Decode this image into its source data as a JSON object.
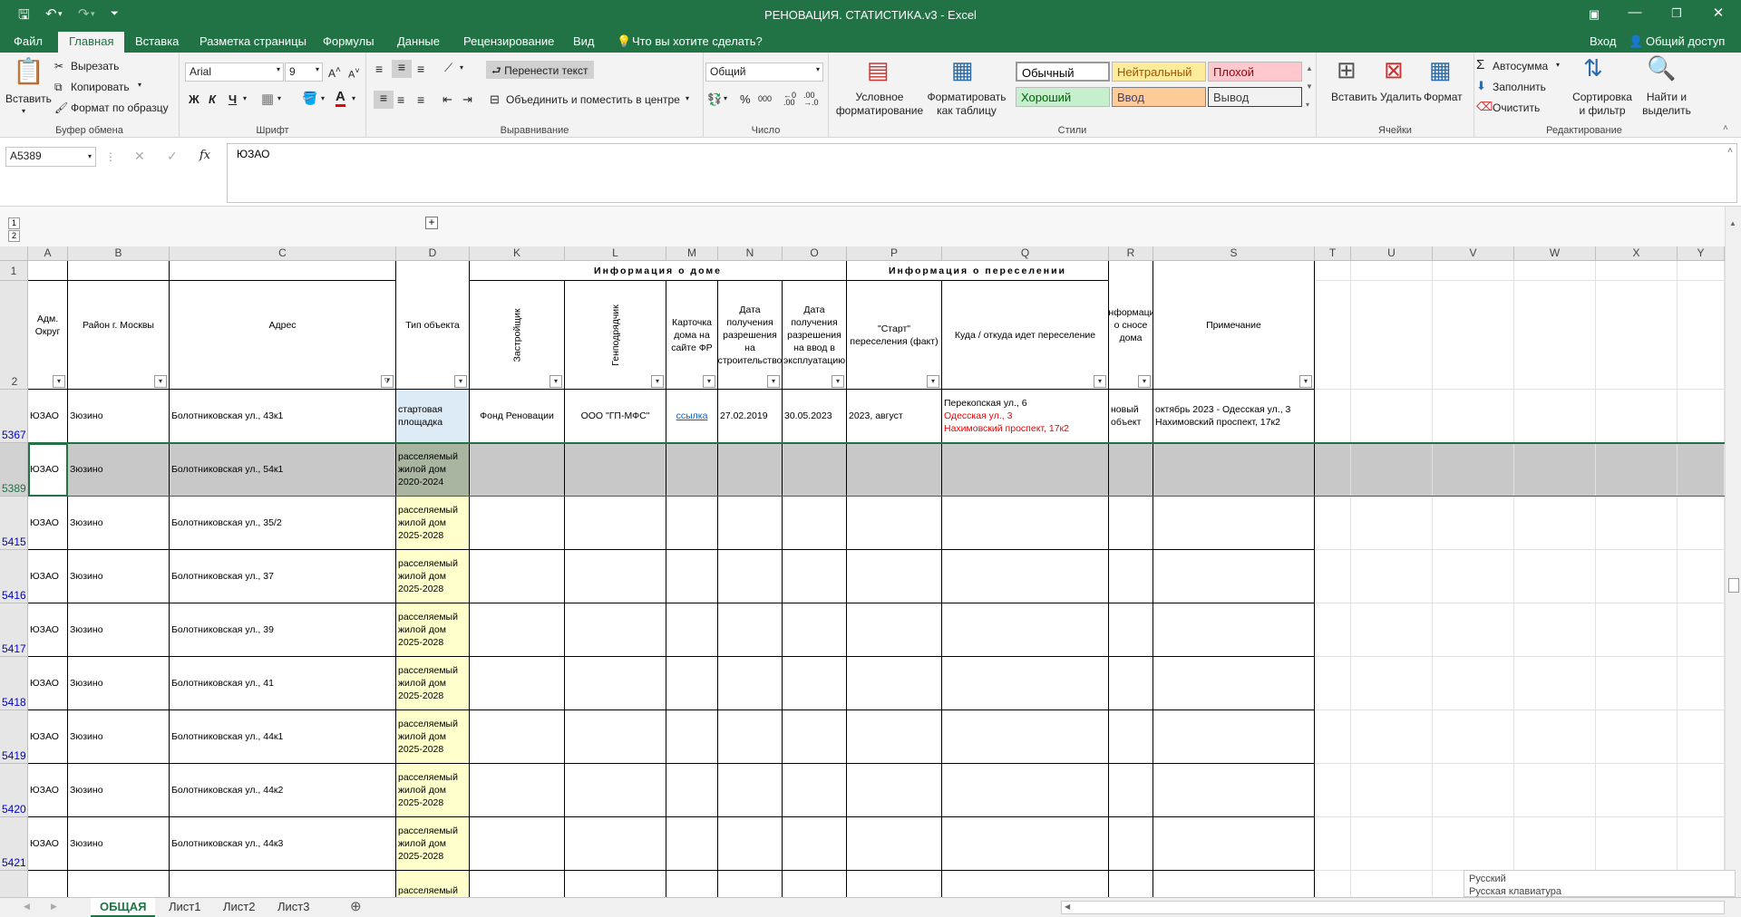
{
  "title": "РЕНОВАЦИЯ. СТАТИСТИКА.v3 - Excel",
  "account": {
    "login": "Вход",
    "share": "Общий доступ"
  },
  "tabs": [
    "Файл",
    "Главная",
    "Вставка",
    "Разметка страницы",
    "Формулы",
    "Данные",
    "Рецензирование",
    "Вид"
  ],
  "tell_me": "Что вы хотите сделать?",
  "ribbon": {
    "clipboard": {
      "paste": "Вставить",
      "cut": "Вырезать",
      "copy": "Копировать",
      "format_painter": "Формат по образцу",
      "label": "Буфер обмена"
    },
    "font": {
      "name": "Arial",
      "size": "9",
      "bold": "Ж",
      "italic": "К",
      "underline": "Ч",
      "label": "Шрифт"
    },
    "alignment": {
      "wrap": "Перенести текст",
      "merge": "Объединить и поместить в центре",
      "label": "Выравнивание"
    },
    "number": {
      "format": "Общий",
      "percent": "%",
      "thousands": "000",
      "label": "Число"
    },
    "styles": {
      "conditional": "Условное форматирование",
      "as_table": "Форматировать как таблицу",
      "normal": "Обычный",
      "neutral": "Нейтральный",
      "bad": "Плохой",
      "good": "Хороший",
      "input": "Ввод",
      "output": "Вывод",
      "label": "Стили"
    },
    "cells": {
      "insert": "Вставить",
      "delete": "Удалить",
      "format": "Формат",
      "label": "Ячейки"
    },
    "editing": {
      "autosum": "Автосумма",
      "fill": "Заполнить",
      "clear": "Очистить",
      "sort": "Сортировка и фильтр",
      "find": "Найти и выделить",
      "label": "Редактирование"
    }
  },
  "formula_bar": {
    "name_box": "A5389",
    "fx": "fx",
    "value": "ЮЗАО"
  },
  "outline_levels": [
    "1",
    "2"
  ],
  "columns": [
    "A",
    "B",
    "C",
    "D",
    "K",
    "L",
    "M",
    "N",
    "O",
    "P",
    "Q",
    "R",
    "S",
    "T",
    "U",
    "V",
    "W",
    "X",
    "Y"
  ],
  "header_groups": {
    "house": "Информация о доме",
    "resettle": "Информация о переселении"
  },
  "headers": {
    "A": "Адм. Округ",
    "B": "Район г. Москвы",
    "C": "Адрес",
    "D": "Тип объекта",
    "K": "Застройщик",
    "L": "Генподрядчик",
    "M": "Карточка дома на сайте ФР",
    "N": "Дата получения разрешения на строительство",
    "O": "Дата получения разрешения на ввод в эксплуатацию",
    "P": "\"Старт\" переселения (факт)",
    "Q": "Куда / откуда идет переселение",
    "R": "Информация о сносе дома",
    "S": "Примечание"
  },
  "rows": [
    {
      "num": "5367",
      "A": "ЮЗАО",
      "B": "Зюзино",
      "C": "Болотниковская ул., 43к1",
      "D": "стартовая площадка",
      "K": "Фонд Реновации",
      "L": "ООО \"ГП-МФС\"",
      "M": "ссылка",
      "N": "27.02.2019",
      "O": "30.05.2023",
      "P": "2023, август",
      "Q1": "Перекопская ул., 6",
      "Q2": "Одесская ул., 3",
      "Q3": "Нахимовский проспект, 17к2",
      "R": "новый объект",
      "S": "октябрь 2023 - Одесская ул., 3 Нахимовский проспект, 17к2"
    },
    {
      "num": "5389",
      "A": "ЮЗАО",
      "B": "Зюзино",
      "C": "Болотниковская ул., 54к1",
      "D": "расселяемый жилой дом 2020-2024"
    },
    {
      "num": "5415",
      "A": "ЮЗАО",
      "B": "Зюзино",
      "C": "Болотниковская ул., 35/2",
      "D": "расселяемый жилой дом 2025-2028"
    },
    {
      "num": "5416",
      "A": "ЮЗАО",
      "B": "Зюзино",
      "C": "Болотниковская ул., 37",
      "D": "расселяемый жилой дом 2025-2028"
    },
    {
      "num": "5417",
      "A": "ЮЗАО",
      "B": "Зюзино",
      "C": "Болотниковская ул., 39",
      "D": "расселяемый жилой дом 2025-2028"
    },
    {
      "num": "5418",
      "A": "ЮЗАО",
      "B": "Зюзино",
      "C": "Болотниковская ул., 41",
      "D": "расселяемый жилой дом 2025-2028"
    },
    {
      "num": "5419",
      "A": "ЮЗАО",
      "B": "Зюзино",
      "C": "Болотниковская ул., 44к1",
      "D": "расселяемый жилой дом 2025-2028"
    },
    {
      "num": "5420",
      "A": "ЮЗАО",
      "B": "Зюзино",
      "C": "Болотниковская ул., 44к2",
      "D": "расселяемый жилой дом 2025-2028"
    },
    {
      "num": "5421",
      "A": "ЮЗАО",
      "B": "Зюзино",
      "C": "Болотниковская ул., 44к3",
      "D": "расселяемый жилой дом 2025-2028"
    },
    {
      "num": "",
      "A": "",
      "B": "",
      "C": "",
      "D": "расселяемый жилой дом"
    }
  ],
  "sheets": [
    "ОБЩАЯ",
    "Лист1",
    "Лист2",
    "Лист3"
  ],
  "lang_popup": {
    "line1": "Русский",
    "line2": "Русская клавиатура"
  },
  "colors": {
    "excel_green": "#217346",
    "start_site_fill": "#ddebf7",
    "resettle_fill": "#ffffcc",
    "selected_row": "#c8c8c8"
  }
}
